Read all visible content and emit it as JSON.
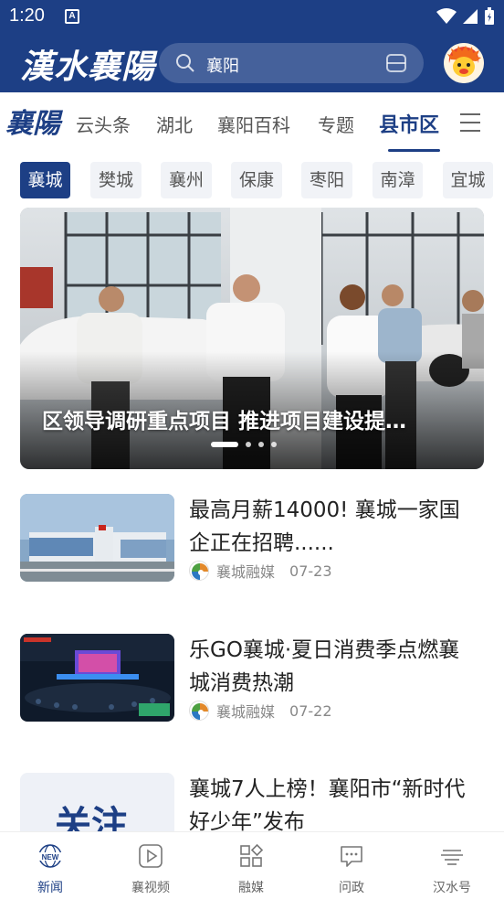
{
  "status_bar": {
    "time": "1:20",
    "notification_icon": "A"
  },
  "app": {
    "logo_text": "漢水襄陽"
  },
  "search": {
    "text": "襄阳"
  },
  "channels": {
    "logo_text": "襄陽",
    "items": [
      "云头条",
      "湖北",
      "襄阳百科",
      "专题",
      "县市区"
    ],
    "active_index": 4
  },
  "subtabs": {
    "items": [
      "襄城",
      "樊城",
      "襄州",
      "保康",
      "枣阳",
      "南漳",
      "宜城"
    ],
    "active_index": 0
  },
  "banner": {
    "title": "区领导调研重点项目 推进项目建设提…",
    "slide_count": 4,
    "active_slide": 0
  },
  "news": [
    {
      "title": "最高月薪14000! 襄城一家国企正在招聘......",
      "source": "襄城融媒",
      "date": "07-23"
    },
    {
      "title": "乐GO襄城·夏日消费季点燃襄城消费热潮",
      "source": "襄城融媒",
      "date": "07-22"
    },
    {
      "title": "襄城7人上榜！襄阳市“新时代好少年”发布",
      "source": "",
      "date": "",
      "thumb_text": "关注"
    }
  ],
  "bottom_nav": {
    "items": [
      {
        "label": "新闻",
        "icon": "news-globe-icon"
      },
      {
        "label": "襄视频",
        "icon": "play-icon"
      },
      {
        "label": "融媒",
        "icon": "grid-icon"
      },
      {
        "label": "问政",
        "icon": "chat-icon"
      },
      {
        "label": "汉水号",
        "icon": "waves-icon"
      }
    ],
    "active_index": 0
  },
  "colors": {
    "brand": "#1d3f85"
  }
}
